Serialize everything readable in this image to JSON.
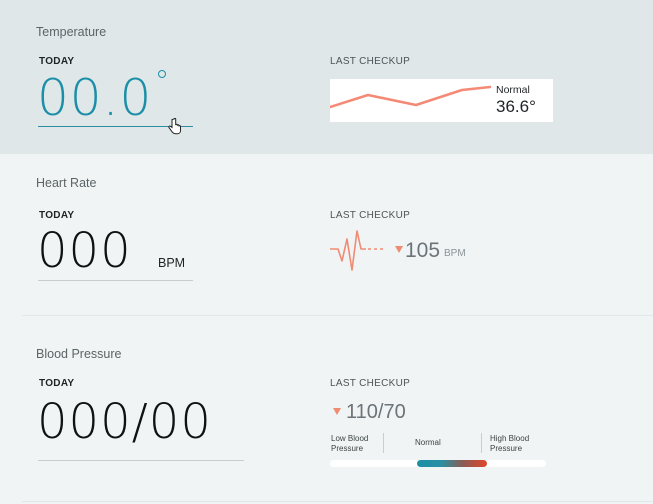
{
  "temperature": {
    "title": "Temperature",
    "today_label": "TODAY",
    "value": "00.0",
    "last_label": "LAST CHECKUP",
    "status": "Normal",
    "reading": "36.6°",
    "colors": {
      "value": "#1b8fa7",
      "sparkline": "#f48a75"
    }
  },
  "heart_rate": {
    "title": "Heart Rate",
    "today_label": "TODAY",
    "value": "000",
    "unit": "BPM",
    "last_label": "LAST CHECKUP",
    "reading": "105",
    "reading_unit": "BPM",
    "colors": {
      "trend": "#f08b72"
    }
  },
  "blood_pressure": {
    "title": "Blood Pressure",
    "today_label": "TODAY",
    "value": "000/00",
    "last_label": "LAST CHECKUP",
    "reading": "110/70",
    "scale": {
      "low_line1": "Low Blood",
      "low_line2": "Pressure",
      "normal": "Normal",
      "high_line1": "High Blood",
      "high_line2": "Pressure"
    },
    "colors": {
      "low": "#1b8fa7",
      "high": "#e3452b"
    }
  },
  "icons": [
    "degree-icon",
    "hand-cursor-icon",
    "heartbeat-icon",
    "down-arrow-icon"
  ]
}
